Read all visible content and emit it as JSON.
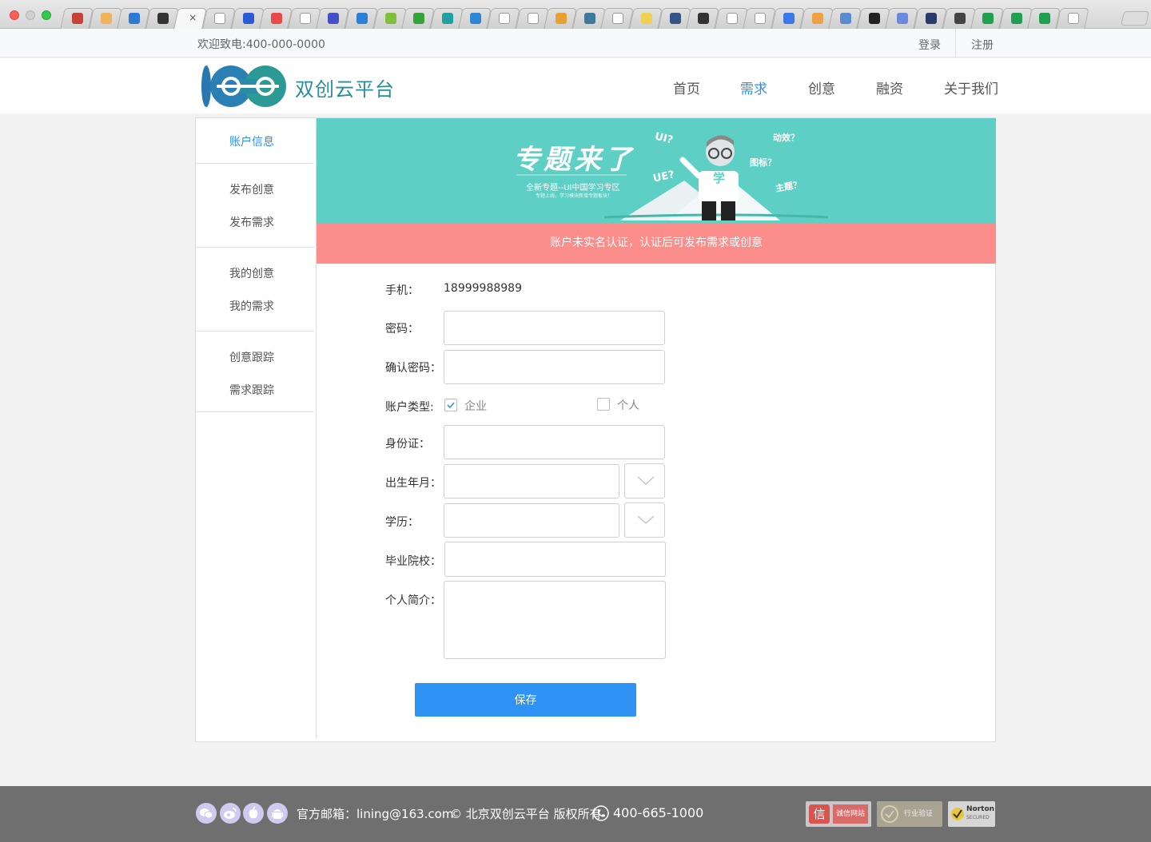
{
  "browser": {
    "tab_count": 36,
    "active_tab_index": 4,
    "favicon_colors": [
      "#c7403a",
      "#f0b35a",
      "#2d7ad6",
      "#333",
      "#f7f7f7",
      "#ffffff",
      "#2c5ad6",
      "#e84a4a",
      "#ffffff",
      "#4450c8",
      "#2b7fd6",
      "#7fbf3a",
      "#33a33a",
      "#20a0a0",
      "#2d86d6",
      "#ffffff",
      "#ffffff",
      "#e8a030",
      "#3c7a9c",
      "#ffffff",
      "#f0d050",
      "#33558a",
      "#333",
      "#ffffff",
      "#ffffff",
      "#3a7ae8",
      "#f0a040",
      "#5a8ad0",
      "#222",
      "#6a8ae0",
      "#2a3a6a",
      "#444",
      "#1fa050",
      "#1fa050",
      "#1fa050",
      "#ffffff"
    ]
  },
  "topbar": {
    "welcome": "欢迎致电:400-000-0000",
    "login": "登录",
    "register": "注册"
  },
  "header": {
    "brand": "双创云平台",
    "logo_text": "100",
    "nav": [
      {
        "label": "首页",
        "active": false
      },
      {
        "label": "需求",
        "active": true
      },
      {
        "label": "创意",
        "active": false
      },
      {
        "label": "融资",
        "active": false
      },
      {
        "label": "关于我们",
        "active": false
      }
    ],
    "active_color": "#2f8fe8"
  },
  "sidebar": {
    "items": [
      {
        "label": "账户信息",
        "active": true
      },
      {
        "label": "发布创意",
        "active": false
      },
      {
        "label": "发布需求",
        "active": false
      },
      {
        "label": "我的创意",
        "active": false
      },
      {
        "label": "我的需求",
        "active": false
      },
      {
        "label": "创意跟踪",
        "active": false
      },
      {
        "label": "需求跟踪",
        "active": false
      }
    ]
  },
  "banner": {
    "headline": "专题来了",
    "subtitle": "全新专题--UI中国学习专区",
    "small": "专题上线，学习模块新增专题板块！",
    "tags": [
      "UI?",
      "UE?",
      "动效？",
      "图标？",
      "主题？"
    ],
    "figure_label": "学",
    "bg_color": "#5ecfc4"
  },
  "alert": {
    "text": "账户未实名认证，认证后可发布需求或创意",
    "color": "#fb8d8b"
  },
  "form": {
    "phone_label": "手机：",
    "phone_value": "18999988989",
    "password_label": "密码：",
    "password_value": "",
    "confirm_label": "确认密码：",
    "confirm_value": "",
    "account_type_label": "账户类型:",
    "account_types": [
      {
        "label": "企业",
        "checked": true
      },
      {
        "label": "个人",
        "checked": false
      }
    ],
    "id_label": "身份证：",
    "id_value": "",
    "birth_label": "出生年月：",
    "birth_value": "",
    "edu_label": "学历：",
    "edu_value": "",
    "school_label": "毕业院校：",
    "school_value": "",
    "bio_label": "个人简介：",
    "bio_value": "",
    "save_label": "保存",
    "save_color": "#2f93f5"
  },
  "footer": {
    "icons": [
      "wechat-icon",
      "weibo-icon",
      "apple-icon",
      "android-icon"
    ],
    "email": "官方邮箱：lining@163.com",
    "copyright": "© 北京双创云平台 版权所有",
    "phone": "400-665-1000",
    "badges": [
      {
        "name": "credit-site-badge",
        "label": "诚信网站",
        "glyph": "信"
      },
      {
        "name": "industry-verify-badge",
        "label": "行业验证"
      },
      {
        "name": "norton-badge",
        "label": "Norton",
        "sub": "SECURED"
      }
    ]
  }
}
